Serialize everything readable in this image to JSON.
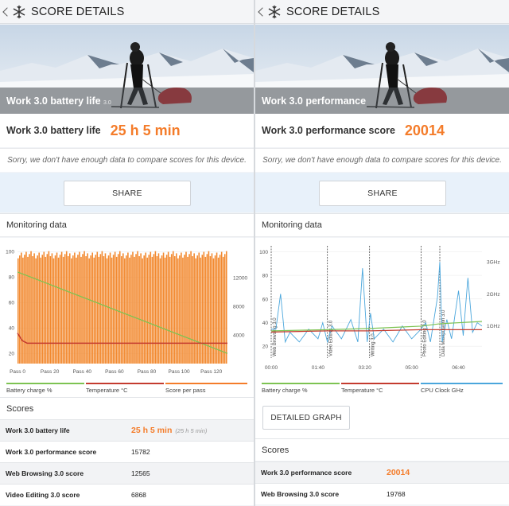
{
  "colors": {
    "accent": "#f47c2a",
    "battery": "#7dc352",
    "temperature": "#c43b2f",
    "cpu": "#4aa6dc"
  },
  "left": {
    "appbar_title": "SCORE DETAILS",
    "hero_label": "Work 3.0 battery life",
    "hero_sub": "3.0",
    "score_label": "Work 3.0 battery life",
    "score_value": "25 h 5 min",
    "sorry": "Sorry, we don't have enough data to compare scores for this device.",
    "share": "SHARE",
    "monitoring": "Monitoring data",
    "legend": [
      "Battery charge %",
      "Temperature °C",
      "Score per pass"
    ],
    "scores_title": "Scores",
    "scores": [
      {
        "name": "Work 3.0 battery life",
        "value": "25 h 5 min",
        "sub": "(25 h 5 min)"
      },
      {
        "name": "Work 3.0 performance score",
        "value": "15782"
      },
      {
        "name": "Web Browsing 3.0 score",
        "value": "12565"
      },
      {
        "name": "Video Editing 3.0 score",
        "value": "6868"
      }
    ]
  },
  "right": {
    "appbar_title": "SCORE DETAILS",
    "hero_label": "Work 3.0 performance",
    "score_label": "Work 3.0 performance score",
    "score_value": "20014",
    "sorry": "Sorry, we don't have enough data to compare scores for this device.",
    "share": "SHARE",
    "monitoring": "Monitoring data",
    "legend": [
      "Battery charge %",
      "Temperature °C",
      "CPU Clock GHz"
    ],
    "detailed_graph": "DETAILED GRAPH",
    "scores_title": "Scores",
    "scores": [
      {
        "name": "Work 3.0 performance score",
        "value": "20014"
      },
      {
        "name": "Web Browsing 3.0 score",
        "value": "19768"
      }
    ]
  },
  "chart_data": [
    {
      "type": "bar",
      "title": "",
      "y_left_ticks": [
        20,
        40,
        60,
        80,
        100
      ],
      "y_right_ticks": [
        4000,
        8000,
        12000
      ],
      "x_ticks": [
        "Pass 0",
        "Pass 20",
        "Pass 40",
        "Pass 60",
        "Pass 80",
        "Pass 100",
        "Pass 120"
      ],
      "x_range": [
        0,
        130
      ],
      "ylim_left": [
        12,
        102
      ],
      "ylim_right": [
        0,
        16000
      ],
      "series": [
        {
          "name": "Score per pass",
          "kind": "bar",
          "passes": 130,
          "value_range": [
            14700,
            15700
          ]
        },
        {
          "name": "Battery charge %",
          "kind": "line",
          "x": [
            0,
            130
          ],
          "y": [
            84,
            20
          ]
        },
        {
          "name": "Temperature °C",
          "kind": "line",
          "x": [
            0,
            1,
            3,
            6,
            10,
            130
          ],
          "y": [
            36,
            34,
            30,
            28,
            28,
            28
          ]
        }
      ]
    },
    {
      "type": "line",
      "title": "",
      "y_left_ticks": [
        20,
        40,
        60,
        80,
        100
      ],
      "y_right_ticks": [
        "1GHz",
        "2GHz",
        "3GHz"
      ],
      "x_ticks": [
        "00:00",
        "01:40",
        "03:20",
        "05:00",
        "06:40"
      ],
      "x_range_min": [
        0,
        450
      ],
      "ylim_left": [
        10,
        105
      ],
      "ylim_right_ghz": [
        0,
        3.5
      ],
      "markers": [
        {
          "label": "Web Browsing 3.0",
          "t": 0
        },
        {
          "label": "Video Editing 3.0",
          "t": 120
        },
        {
          "label": "Writing 3.0",
          "t": 210
        },
        {
          "label": "Photo Editing 3.0",
          "t": 320
        },
        {
          "label": "Data Manipulation 3.0",
          "t": 360
        }
      ],
      "series": [
        {
          "name": "Battery charge %",
          "x": [
            0,
            120,
            210,
            320,
            360,
            450
          ],
          "y": [
            33,
            34,
            35,
            37,
            39,
            41
          ]
        },
        {
          "name": "Temperature °C",
          "x": [
            0,
            120,
            210,
            320,
            450
          ],
          "y": [
            32,
            33,
            33,
            34,
            34
          ]
        },
        {
          "name": "CPU Clock GHz",
          "x": [
            0,
            10,
            20,
            30,
            40,
            60,
            80,
            100,
            110,
            120,
            130,
            150,
            170,
            185,
            195,
            205,
            212,
            220,
            240,
            260,
            280,
            300,
            320,
            330,
            340,
            355,
            360,
            365,
            375,
            385,
            400,
            410,
            420,
            430,
            440,
            450
          ],
          "y": [
            0.9,
            0.9,
            2.0,
            0.5,
            0.8,
            0.5,
            0.9,
            0.6,
            1.1,
            0.5,
            1.0,
            0.6,
            1.2,
            0.5,
            2.8,
            0.5,
            1.4,
            0.6,
            0.9,
            0.5,
            1.0,
            0.6,
            0.9,
            1.1,
            0.5,
            1.9,
            3.0,
            0.5,
            1.2,
            0.6,
            2.1,
            0.7,
            2.5,
            0.8,
            1.1,
            1.0
          ]
        }
      ]
    }
  ]
}
